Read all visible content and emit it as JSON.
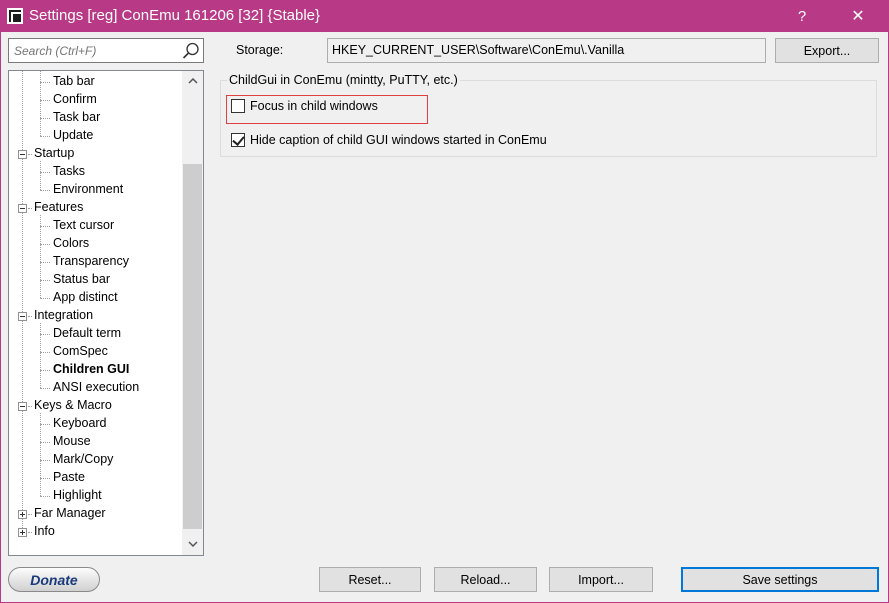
{
  "window": {
    "title": "Settings [reg] ConEmu 161206 [32] {Stable}",
    "help_label": "?",
    "close_label": "✕",
    "accent_color": "#b83a86"
  },
  "search": {
    "placeholder": "Search (Ctrl+F)"
  },
  "tree": {
    "items": [
      {
        "label": "Tab bar",
        "level": 1
      },
      {
        "label": "Confirm",
        "level": 1
      },
      {
        "label": "Task bar",
        "level": 1
      },
      {
        "label": "Update",
        "level": 1
      },
      {
        "label": "Startup",
        "level": 0,
        "expander": "minus"
      },
      {
        "label": "Tasks",
        "level": 1
      },
      {
        "label": "Environment",
        "level": 1
      },
      {
        "label": "Features",
        "level": 0,
        "expander": "minus"
      },
      {
        "label": "Text cursor",
        "level": 1
      },
      {
        "label": "Colors",
        "level": 1
      },
      {
        "label": "Transparency",
        "level": 1
      },
      {
        "label": "Status bar",
        "level": 1
      },
      {
        "label": "App distinct",
        "level": 1
      },
      {
        "label": "Integration",
        "level": 0,
        "expander": "minus"
      },
      {
        "label": "Default term",
        "level": 1
      },
      {
        "label": "ComSpec",
        "level": 1
      },
      {
        "label": "Children GUI",
        "level": 1,
        "selected": true
      },
      {
        "label": "ANSI execution",
        "level": 1
      },
      {
        "label": "Keys & Macro",
        "level": 0,
        "expander": "minus"
      },
      {
        "label": "Keyboard",
        "level": 1
      },
      {
        "label": "Mouse",
        "level": 1
      },
      {
        "label": "Mark/Copy",
        "level": 1
      },
      {
        "label": "Paste",
        "level": 1
      },
      {
        "label": "Highlight",
        "level": 1
      },
      {
        "label": "Far Manager",
        "level": 0,
        "expander": "plus"
      },
      {
        "label": "Info",
        "level": 0,
        "expander": "plus"
      }
    ]
  },
  "storage": {
    "label": "Storage:",
    "value": "HKEY_CURRENT_USER\\Software\\ConEmu\\.Vanilla",
    "export_label": "Export..."
  },
  "child_gui": {
    "group_title": "ChildGui in ConEmu (mintty, PuTTY, etc.)",
    "focus_label": "Focus in child windows",
    "focus_checked": false,
    "hide_caption_label": "Hide caption of child GUI windows started in ConEmu",
    "hide_caption_checked": true
  },
  "footer": {
    "donate_label": "Donate",
    "reset_label": "Reset...",
    "reload_label": "Reload...",
    "import_label": "Import...",
    "save_label": "Save settings"
  }
}
